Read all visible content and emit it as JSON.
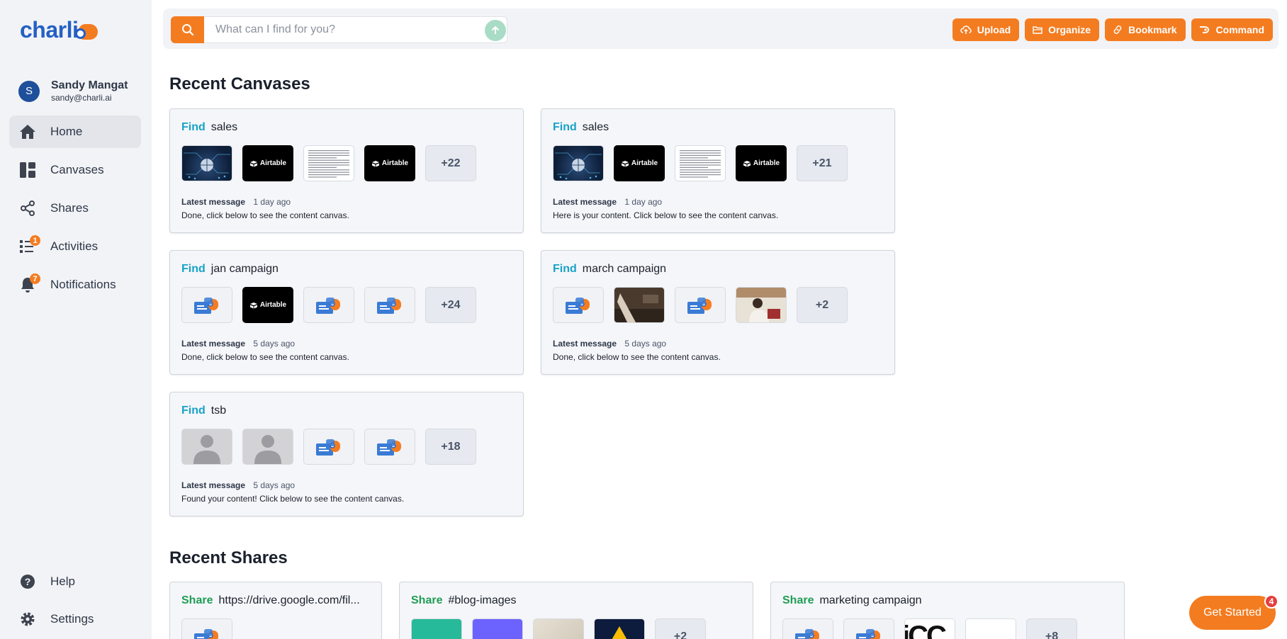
{
  "app": {
    "logo_text": "charli"
  },
  "user": {
    "initial": "S",
    "name": "Sandy Mangat",
    "email": "sandy@charli.ai"
  },
  "nav": {
    "items": [
      {
        "label": "Home",
        "icon": "home-icon",
        "active": true
      },
      {
        "label": "Canvases",
        "icon": "canvases-icon"
      },
      {
        "label": "Shares",
        "icon": "share-icon"
      },
      {
        "label": "Activities",
        "icon": "activities-icon",
        "badge": "1"
      },
      {
        "label": "Notifications",
        "icon": "bell-icon",
        "badge": "7"
      }
    ],
    "bottom": [
      {
        "label": "Help",
        "icon": "help-icon"
      },
      {
        "label": "Settings",
        "icon": "gear-icon"
      }
    ]
  },
  "search": {
    "placeholder": "What can I find for you?"
  },
  "actions": [
    {
      "label": "Upload",
      "icon": "upload-cloud-icon"
    },
    {
      "label": "Organize",
      "icon": "folder-icon"
    },
    {
      "label": "Bookmark",
      "icon": "link-icon"
    },
    {
      "label": "Command",
      "icon": "command-icon"
    }
  ],
  "recent_canvases": {
    "title": "Recent Canvases",
    "cards": [
      {
        "kind": "Find",
        "query": "sales",
        "thumbs": [
          "globe",
          "airtable",
          "doc",
          "airtable"
        ],
        "more": "+22",
        "latest_label": "Latest message",
        "latest_time": "1 day ago",
        "message": "Done, click below to see the content canvas."
      },
      {
        "kind": "Find",
        "query": "sales",
        "thumbs": [
          "globe",
          "airtable",
          "doc",
          "airtable"
        ],
        "more": "+21",
        "latest_label": "Latest message",
        "latest_time": "1 day ago",
        "message": "Here is your content. Click below to see the content canvas."
      },
      {
        "kind": "Find",
        "query": "jan campaign",
        "thumbs": [
          "charli",
          "airtable",
          "charli",
          "charli"
        ],
        "more": "+24",
        "latest_label": "Latest message",
        "latest_time": "5 days ago",
        "message": "Done, click below to see the content canvas."
      },
      {
        "kind": "Find",
        "query": "march campaign",
        "thumbs": [
          "charli",
          "photo-desk",
          "charli",
          "photo-people"
        ],
        "more": "+2",
        "latest_label": "Latest message",
        "latest_time": "5 days ago",
        "message": "Done, click below to see the content canvas."
      },
      {
        "kind": "Find",
        "query": "tsb",
        "thumbs": [
          "person",
          "person",
          "charli",
          "charli"
        ],
        "more": "+18",
        "latest_label": "Latest message",
        "latest_time": "5 days ago",
        "message": "Found your content! Click below to see the content canvas."
      }
    ]
  },
  "airtable_label": "Airtable",
  "recent_shares": {
    "title": "Recent Shares",
    "cards": [
      {
        "kind": "Share",
        "query": "https://drive.google.com/fil...",
        "thumbs": [
          "charli"
        ],
        "more": ""
      },
      {
        "kind": "Share",
        "query": "#blog-images",
        "thumbs": [
          "teal",
          "purple",
          "paper",
          "gdrive"
        ],
        "more": "+2"
      },
      {
        "kind": "Share",
        "query": "marketing campaign",
        "thumbs": [
          "charli",
          "charli",
          "text-cc",
          "chart"
        ],
        "more": "+8"
      }
    ]
  },
  "get_started": {
    "label": "Get Started",
    "badge": "4"
  },
  "colors": {
    "accent": "#f47c20",
    "brand_blue": "#2460c4",
    "find_blue": "#17a2c8",
    "share_green": "#1f9d55"
  }
}
